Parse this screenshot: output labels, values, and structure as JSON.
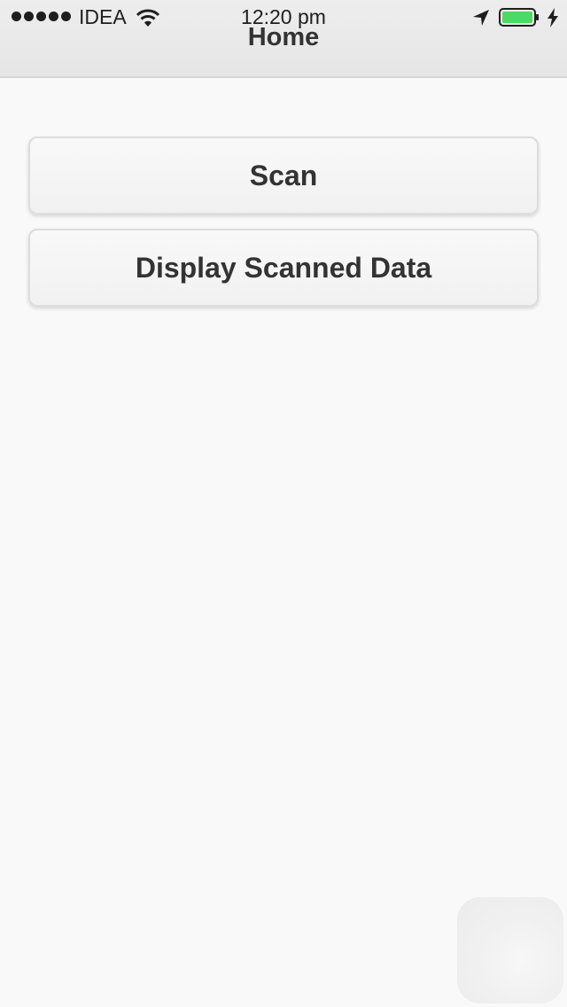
{
  "status_bar": {
    "carrier": "IDEA",
    "time": "12:20 pm",
    "battery_color": "#4cd964"
  },
  "nav": {
    "title": "Home"
  },
  "buttons": {
    "scan_label": "Scan",
    "display_label": "Display Scanned Data"
  },
  "icons": {
    "signal": "signal-dots-icon",
    "wifi": "wifi-icon",
    "location": "location-arrow-icon",
    "battery": "battery-icon",
    "charging": "charging-bolt-icon",
    "assistive": "assistive-touch-icon"
  }
}
